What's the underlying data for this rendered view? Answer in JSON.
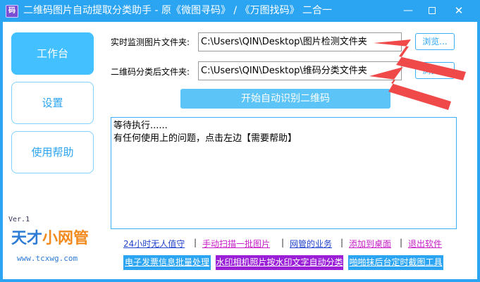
{
  "window": {
    "title": "二维码图片自动提取分类助手 - 原《微图寻码》 / 《万图找码》 二合一",
    "icon_text": "码",
    "minimize": "—",
    "close": "✕"
  },
  "sidebar": {
    "items": [
      {
        "label": "工作台",
        "active": true
      },
      {
        "label": "设置",
        "active": false
      },
      {
        "label": "使用帮助",
        "active": false
      }
    ],
    "version": "Ver.1",
    "logo_part1": "天才",
    "logo_part2": "小网管",
    "logo_url": "www.tcxwg.com"
  },
  "form": {
    "monitor_label": "实时监测图片文件夹:",
    "monitor_path": "C:\\Users\\QIN\\Desktop\\图片检测文件夹",
    "output_label": "二维码分类后文件夹:",
    "output_path": "C:\\Users\\QIN\\Desktop\\维码分类文件夹",
    "browse_label": "浏览...",
    "start_label": "开始自动识别二维码"
  },
  "log": {
    "lines": [
      "等待执行......",
      "有任何使用上的问题，点击左边【需要帮助】"
    ]
  },
  "links": {
    "items": [
      "24小时无人值守",
      "手动扫描一批图片",
      "网管的业务",
      "添加到桌面",
      "退出软件"
    ],
    "separator": "|"
  },
  "tools": {
    "items": [
      "电子发票信息批量处理",
      "水印相机照片按水印文字自动分类",
      "啪啪抹后台定时截图工具"
    ]
  },
  "colors": {
    "accent": "#2ba4f2",
    "arrow": "#f0494a",
    "link_blue": "#2244cc",
    "link_magenta": "#c81ec8",
    "tool_purple": "#9b1fd6"
  }
}
